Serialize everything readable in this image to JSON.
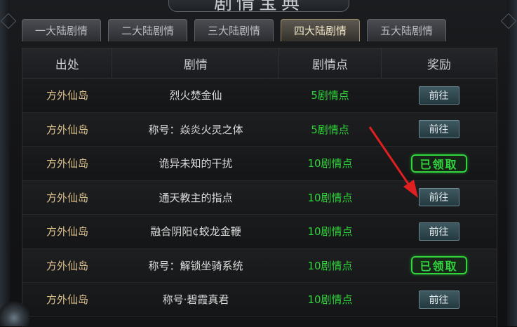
{
  "window": {
    "title": "剧情宝典"
  },
  "tabs": [
    {
      "label": "一大陆剧情"
    },
    {
      "label": "二大陆剧情"
    },
    {
      "label": "三大陆剧情"
    },
    {
      "label": "四大陆剧情",
      "active": true
    },
    {
      "label": "五大陆剧情"
    }
  ],
  "table": {
    "headers": [
      "出处",
      "剧情",
      "剧情点",
      "奖励"
    ],
    "rows": [
      {
        "source": "方外仙岛",
        "story": "烈火焚金仙",
        "points": "5剧情点",
        "reward": "前往"
      },
      {
        "source": "方外仙岛",
        "story": "称号：焱炎火灵之体",
        "points": "5剧情点",
        "reward": "前往"
      },
      {
        "source": "方外仙岛",
        "story": "诡异未知的干扰",
        "points": "10剧情点",
        "reward": "已领取"
      },
      {
        "source": "方外仙岛",
        "story": "通天教主的指点",
        "points": "10剧情点",
        "reward": "前往"
      },
      {
        "source": "方外仙岛",
        "story": "融合阴阳¢蛟龙金鞭",
        "points": "10剧情点",
        "reward": "前往"
      },
      {
        "source": "方外仙岛",
        "story": "称号：解锁坐骑系统",
        "points": "10剧情点",
        "reward": "已领取"
      },
      {
        "source": "方外仙岛",
        "story": "称号·碧霞真君",
        "points": "10剧情点",
        "reward": "前往"
      }
    ]
  },
  "colors": {
    "points": "#2fd43a",
    "source": "#dcc08c",
    "claimed": "#33d43e",
    "arrow": "#e02020"
  }
}
